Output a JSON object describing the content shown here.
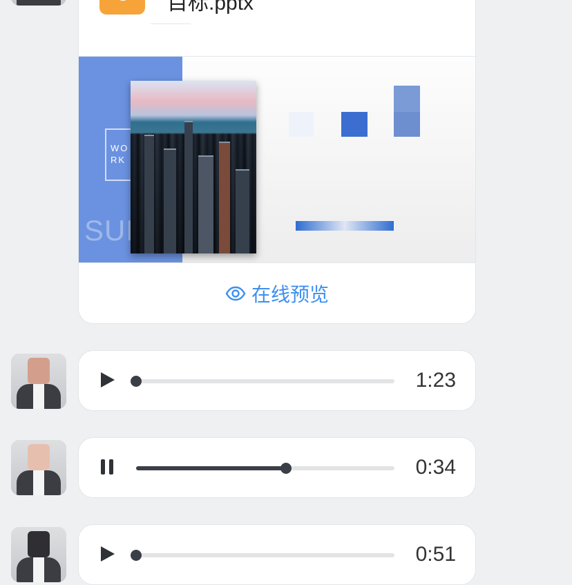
{
  "file_message": {
    "file_name": "目标.pptx",
    "file_icon": "pptx-file-icon",
    "preview_label": "在线预览",
    "preview_icon": "eye-icon",
    "thumbnail": {
      "work_text": "WO\nRK",
      "summary_text": "SUMMARY"
    },
    "accent_color": "#3d8ff0",
    "icon_color": "#f6a43a"
  },
  "voice_messages": [
    {
      "state": "paused",
      "control_icon": "play-icon",
      "duration": "1:23",
      "progress": 0.0
    },
    {
      "state": "playing",
      "control_icon": "pause-icon",
      "duration": "0:34",
      "progress": 0.58
    },
    {
      "state": "paused",
      "control_icon": "play-icon",
      "duration": "0:51",
      "progress": 0.0
    }
  ]
}
